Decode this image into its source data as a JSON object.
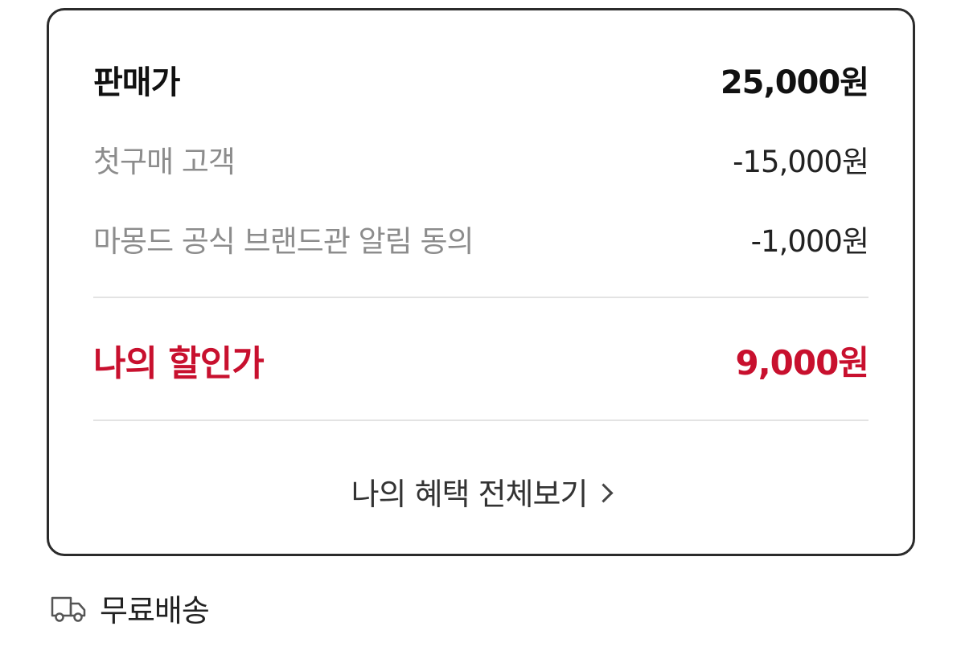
{
  "price_summary": {
    "sale_price": {
      "label": "판매가",
      "value": "25,000원"
    },
    "discounts": [
      {
        "label": "첫구매 고객",
        "value": "-15,000원"
      },
      {
        "label": "마몽드 공식 브랜드관 알림 동의",
        "value": "-1,000원"
      }
    ],
    "final_price": {
      "label": "나의 할인가",
      "value": "9,000원"
    },
    "benefits_link": {
      "label": "나의 혜택 전체보기",
      "icon": "chevron-right-icon"
    }
  },
  "shipping": {
    "icon": "truck-icon",
    "label": "무료배송"
  },
  "colors": {
    "accent": "#c8102e",
    "muted_text": "#8c8c8c",
    "border": "#2b2b2b",
    "divider": "#e3e3e3"
  }
}
